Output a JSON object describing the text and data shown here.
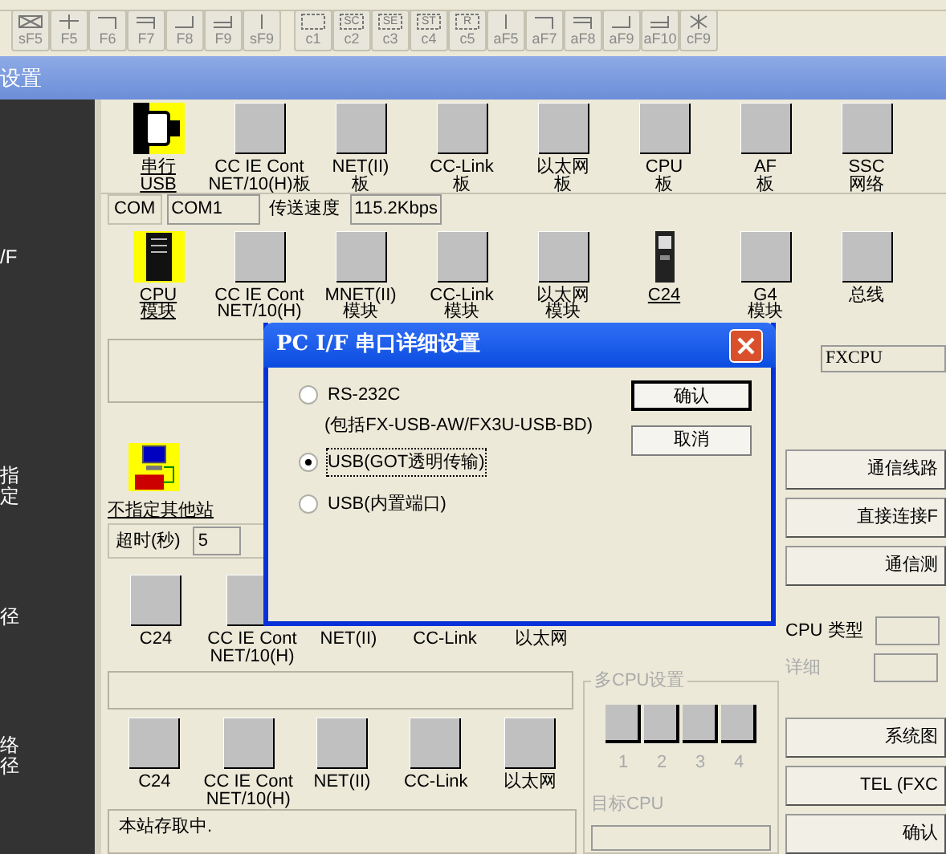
{
  "toolbar": [
    {
      "key": "sF5",
      "kind": "boxx"
    },
    {
      "key": "F5",
      "kind": "plus"
    },
    {
      "key": "F6",
      "kind": "cornerr"
    },
    {
      "key": "F7",
      "kind": "cornerd"
    },
    {
      "key": "F8",
      "kind": "cornerl"
    },
    {
      "key": "F9",
      "kind": "doublel"
    },
    {
      "key": "sF9",
      "kind": "vline"
    },
    {
      "key": "c1",
      "kind": "dashed"
    },
    {
      "key": "c2",
      "kind": "dashed",
      "tag": "SC"
    },
    {
      "key": "c3",
      "kind": "dashed",
      "tag": "SE"
    },
    {
      "key": "c4",
      "kind": "dashed",
      "tag": "ST"
    },
    {
      "key": "c5",
      "kind": "dashed",
      "tag": "R"
    },
    {
      "key": "aF5",
      "kind": "vline"
    },
    {
      "key": "aF7",
      "kind": "cornerr"
    },
    {
      "key": "aF8",
      "kind": "cornerd"
    },
    {
      "key": "aF9",
      "kind": "cornerl"
    },
    {
      "key": "aF10",
      "kind": "doublel"
    },
    {
      "key": "cF9",
      "kind": "star"
    }
  ],
  "window": {
    "title": "设置"
  },
  "sidebar": [
    "/F",
    "指定",
    "径",
    "络径"
  ],
  "pc_side": [
    {
      "lines": [
        "串行",
        "USB"
      ],
      "kind": "serial",
      "selected": true
    },
    {
      "lines": [
        "CC IE Cont",
        "NET/10(H)板"
      ],
      "kind": "blank",
      "selected": false
    },
    {
      "lines": [
        "NET(II)",
        "板"
      ],
      "kind": "blank",
      "selected": false
    },
    {
      "lines": [
        "CC-Link",
        "板"
      ],
      "kind": "blank",
      "selected": false
    },
    {
      "lines": [
        "以太网",
        "板"
      ],
      "kind": "blank",
      "selected": false
    },
    {
      "lines": [
        "CPU",
        "板"
      ],
      "kind": "blank",
      "selected": false
    },
    {
      "lines": [
        "AF",
        "板"
      ],
      "kind": "blank",
      "selected": false
    },
    {
      "lines": [
        "SSC",
        "网络"
      ],
      "kind": "blank",
      "selected": false
    }
  ],
  "com_row": {
    "port_label": "COM",
    "port": "COM1",
    "speed_label": "传送速度",
    "speed": "115.2Kbps"
  },
  "plc_side": [
    {
      "lines": [
        "CPU",
        "模块"
      ],
      "kind": "cpu",
      "selected": true
    },
    {
      "lines": [
        "CC IE Cont",
        "NET/10(H)"
      ],
      "kind": "blank",
      "selected": false
    },
    {
      "lines": [
        "MNET(II)",
        "模块"
      ],
      "kind": "blank",
      "selected": false
    },
    {
      "lines": [
        "CC-Link",
        "模块"
      ],
      "kind": "blank",
      "selected": false
    },
    {
      "lines": [
        "以太网",
        "模块"
      ],
      "kind": "blank",
      "selected": false
    },
    {
      "lines": [
        "C24"
      ],
      "kind": "phone",
      "selected": false
    },
    {
      "lines": [
        "G4",
        "模块"
      ],
      "kind": "blank",
      "selected": false
    },
    {
      "lines": [
        "总线"
      ],
      "kind": "blank",
      "selected": false
    }
  ],
  "plc_type": "FXCPU",
  "other_station": {
    "label": "不指定其他站",
    "timeout_label": "超时(秒)",
    "timeout": "5"
  },
  "route_1": [
    {
      "lines": [
        "C24"
      ],
      "kind": "tile"
    },
    {
      "lines": [
        "CC IE Cont",
        "NET/10(H)"
      ],
      "kind": "tile"
    },
    {
      "lines": [
        "NET(II)"
      ],
      "kind": "label"
    },
    {
      "lines": [
        "CC-Link"
      ],
      "kind": "label"
    },
    {
      "lines": [
        "以太网"
      ],
      "kind": "label"
    }
  ],
  "route_2": [
    {
      "lines": [
        "C24"
      ]
    },
    {
      "lines": [
        "CC IE Cont",
        "NET/10(H)"
      ]
    },
    {
      "lines": [
        "NET(II)"
      ]
    },
    {
      "lines": [
        "CC-Link"
      ]
    },
    {
      "lines": [
        "以太网"
      ]
    }
  ],
  "status": "本站存取中.",
  "multi_cpu": {
    "title": "多CPU设置",
    "slots": [
      "1",
      "2",
      "3",
      "4"
    ],
    "target_label": "目标CPU",
    "disabled": true
  },
  "right_buttons_top": [
    "通信线路",
    "直接连接F",
    "通信测"
  ],
  "cpu_type_label": "CPU 类型",
  "detail_label": "详细",
  "right_buttons_bottom": [
    "系统图",
    "TEL (FXC",
    "确认"
  ],
  "dialog": {
    "title": "PC I/F 串口详细设置",
    "options": [
      {
        "label": "RS-232C",
        "note": "(包括FX-USB-AW/FX3U-USB-BD)",
        "selected": false
      },
      {
        "label": "USB(GOT透明传输)",
        "selected": true
      },
      {
        "label": "USB(内置端口)",
        "selected": false
      }
    ],
    "buttons": [
      "确认",
      "取消"
    ]
  }
}
